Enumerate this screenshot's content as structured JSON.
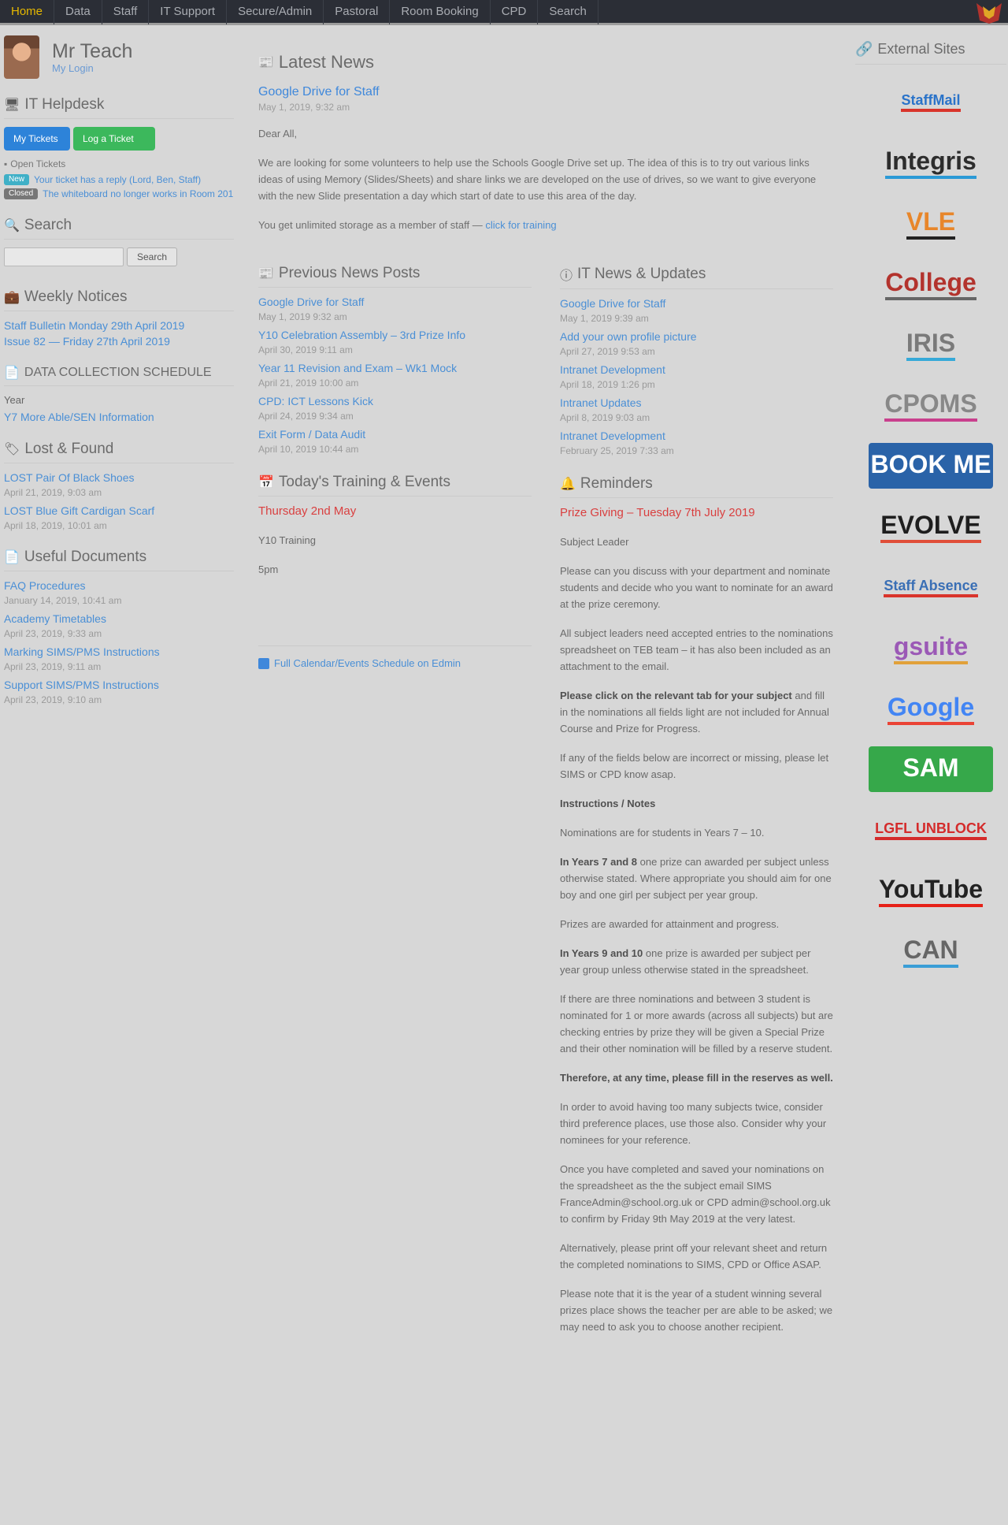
{
  "nav": {
    "items": [
      "Home",
      "Data",
      "Staff",
      "IT Support",
      "Secure/Admin",
      "Pastoral",
      "Room Booking",
      "CPD",
      "Search"
    ],
    "active_index": 0
  },
  "profile": {
    "name": "Mr Teach",
    "link": "My Login"
  },
  "helpdesk": {
    "title": "IT Helpdesk",
    "btn_new": "My Tickets",
    "btn_log": "Log a Ticket",
    "open_label": "Open Tickets",
    "tickets": [
      {
        "badge": "New",
        "text": "Your ticket has a reply (Lord, Ben, Staff)"
      },
      {
        "badge": "Closed",
        "text": "The whiteboard no longer works in Room 201"
      }
    ]
  },
  "search": {
    "title": "Search",
    "placeholder": "",
    "button": "Search"
  },
  "notices": {
    "title": "Weekly Notices",
    "items": [
      "Staff Bulletin Monday 29th April 2019",
      "Issue 82 — Friday 27th April 2019"
    ]
  },
  "data_collection": {
    "title": "DATA COLLECTION SCHEDULE",
    "label": "Year",
    "link": "Y7 More Able/SEN Information"
  },
  "lost_found": {
    "title": "Lost & Found",
    "items": [
      {
        "link": "LOST Pair Of Black Shoes",
        "date": "April 21, 2019, 9:03 am"
      },
      {
        "link": "LOST Blue Gift Cardigan Scarf",
        "date": "April 18, 2019, 10:01 am"
      }
    ]
  },
  "documents": {
    "title": "Useful Documents",
    "items": [
      {
        "link": "FAQ Procedures",
        "date": "January 14, 2019, 10:41 am"
      },
      {
        "link": "Academy Timetables",
        "date": "April 23, 2019, 9:33 am"
      },
      {
        "link": "Marking SIMS/PMS Instructions",
        "date": "April 23, 2019, 9:11 am"
      },
      {
        "link": "Support SIMS/PMS Instructions",
        "date": "April 23, 2019, 9:10 am"
      }
    ]
  },
  "latest_news": {
    "title": "Latest News",
    "headline": "Google Drive for Staff",
    "meta": "May 1, 2019, 9:32 am",
    "greeting": "Dear All,",
    "body": "We are looking for some volunteers to help use the Schools Google Drive set up. The idea of this is to try out various links ideas of using Memory (Slides/Sheets) and share links we are developed on the use of drives, so we want to give everyone with the new Slide presentation a day which start of date to use this area of the day.",
    "footer_prefix": "You get unlimited storage as a member of staff —",
    "footer_link": "click for training"
  },
  "previous_posts": {
    "title": "Previous News Posts",
    "items": [
      {
        "link": "Google Drive for Staff",
        "date": "May 1, 2019 9:32 am"
      },
      {
        "link": "Y10 Celebration Assembly – 3rd Prize Info",
        "date": "April 30, 2019 9:11 am"
      },
      {
        "link": "Year 11 Revision and Exam – Wk1 Mock",
        "date": "April 21, 2019 10:00 am"
      },
      {
        "link": "CPD: ICT Lessons Kick",
        "date": "April 24, 2019 9:34 am"
      },
      {
        "link": "Exit Form / Data Audit",
        "date": "April 10, 2019 10:44 am"
      }
    ]
  },
  "it_news": {
    "title": "IT News & Updates",
    "items": [
      {
        "link": "Google Drive for Staff",
        "date": "May 1, 2019 9:39 am"
      },
      {
        "link": "Add your own profile picture",
        "date": "April 27, 2019 9:53 am"
      },
      {
        "link": "Intranet Development",
        "date": "April 18, 2019 1:26 pm"
      },
      {
        "link": "Intranet Updates",
        "date": "April 8, 2019 9:03 am"
      },
      {
        "link": "Intranet Development",
        "date": "February 25, 2019 7:33 am"
      }
    ]
  },
  "training": {
    "title": "Today's Training & Events",
    "date_heading": "Thursday 2nd May",
    "lines": [
      "Y10 Training",
      "5pm"
    ],
    "calendar_link": "Full Calendar/Events Schedule on Edmin"
  },
  "reminders": {
    "title": "Reminders",
    "heading": "Prize Giving – Tuesday 7th July 2019",
    "paragraphs": [
      {
        "bold": "",
        "text": "Subject Leader"
      },
      {
        "bold": "",
        "text": "Please can you discuss with your department and nominate students and decide who you want to nominate for an award at the prize ceremony."
      },
      {
        "bold": "",
        "text": "All subject leaders need accepted entries to the nominations spreadsheet on TEB team – it has also been included as an attachment to the email."
      },
      {
        "bold": "Please click on the relevant tab for your subject",
        "text": "and fill in the nominations all fields light are not included for Annual Course and Prize for Progress."
      },
      {
        "bold": "",
        "text": "If any of the fields below are incorrect or missing, please let SIMS or CPD know asap."
      },
      {
        "bold": "Instructions / Notes",
        "text": ""
      },
      {
        "bold": "",
        "text": "Nominations are for students in Years 7 – 10."
      },
      {
        "bold": "In Years 7 and 8",
        "text": "one prize can awarded per subject unless otherwise stated. Where appropriate you should aim for one boy and one girl per subject per year group."
      },
      {
        "bold": "",
        "text": "Prizes are awarded for attainment and progress."
      },
      {
        "bold": "In Years 9 and 10",
        "text": "one prize is awarded per subject per year group unless otherwise stated in the spreadsheet."
      },
      {
        "bold": "",
        "text": "If there are three nominations and between 3 student is nominated for 1 or more awards (across all subjects) but are checking entries by prize they will be given a Special Prize and their other nomination will be filled by a reserve student."
      },
      {
        "bold": "Therefore, at any time, please fill in the reserves as well.",
        "text": ""
      },
      {
        "bold": "",
        "text": "In order to avoid having too many subjects twice, consider third preference places, use those also. Consider why your nominees for your reference."
      },
      {
        "bold": "",
        "text": "Once you have completed and saved your nominations on the spreadsheet as the the subject email SIMS FranceAdmin@school.org.uk or CPD admin@school.org.uk to confirm by Friday 9th May 2019 at the very latest."
      },
      {
        "bold": "",
        "text": "Alternatively, please print off your relevant sheet and return the completed nominations to SIMS, CPD or Office ASAP."
      },
      {
        "bold": "",
        "text": "Please note that it is the year of a student winning several prizes place shows the teacher per are able to be asked; we may need to ask you to choose another recipient."
      }
    ]
  },
  "external": {
    "title": "External Sites",
    "logos": [
      {
        "name": "StaffMail",
        "fg": "#2a73c9",
        "fg2": "#d9342b",
        "bg": "transparent"
      },
      {
        "name": "Integris",
        "fg": "#2d2d2d",
        "fg2": "#2b9ad6",
        "bg": "transparent"
      },
      {
        "name": "VLE",
        "fg": "#e8862a",
        "fg2": "#222",
        "bg": "transparent"
      },
      {
        "name": "College",
        "fg": "#b3332d",
        "fg2": "#666",
        "bg": "transparent"
      },
      {
        "name": "IRIS",
        "fg": "#7a7a7a",
        "fg2": "#36a9d8",
        "bg": "transparent"
      },
      {
        "name": "CPOMS",
        "fg": "#888",
        "fg2": "#c9408d",
        "bg": "transparent"
      },
      {
        "name": "BOOK ME",
        "fg": "#ffffff",
        "fg2": "#2a63a8",
        "bg": "#2a63a8"
      },
      {
        "name": "EVOLVE",
        "fg": "#1e1e1e",
        "fg2": "#e04e39",
        "bg": "transparent"
      },
      {
        "name": "Staff Absence",
        "fg": "#3a6fb5",
        "fg2": "#d9342b",
        "bg": "transparent"
      },
      {
        "name": "gsuite",
        "fg": "#9b59b6",
        "fg2": "#e1a13a",
        "bg": "transparent"
      },
      {
        "name": "Google",
        "fg": "#4285f4",
        "fg2": "#ea4335",
        "bg": "transparent"
      },
      {
        "name": "SAM",
        "fg": "#ffffff",
        "fg2": "#36a84a",
        "bg": "#36a84a"
      },
      {
        "name": "LGFL UNBLOCK",
        "fg": "#d42b2b",
        "fg2": "#d42b2b",
        "bg": "transparent"
      },
      {
        "name": "YouTube",
        "fg": "#222",
        "fg2": "#e62117",
        "bg": "transparent"
      },
      {
        "name": "CAN",
        "fg": "#666",
        "fg2": "#3a9dd6",
        "bg": "transparent"
      }
    ]
  }
}
